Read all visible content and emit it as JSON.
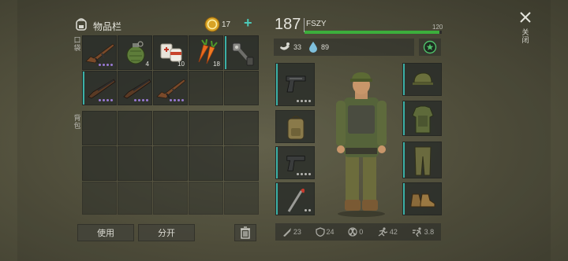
{
  "header": {
    "inventory_title": "物品栏",
    "coins_value": "17",
    "add_label": "+",
    "close_label": "关闭"
  },
  "side_labels": {
    "pockets": "口袋",
    "backpack": "背包"
  },
  "pocket_items": [
    {
      "name": "ak-rifle",
      "count": "",
      "dots": 4
    },
    {
      "name": "grenade",
      "count": "4",
      "dots": 0
    },
    {
      "name": "bandage-pills",
      "count": "10",
      "dots": 0
    },
    {
      "name": "carrots",
      "count": "18",
      "dots": 0
    },
    {
      "name": "mechanism",
      "count": "",
      "dots": 0
    },
    {
      "name": "shotgun",
      "count": "",
      "dots": 4
    },
    {
      "name": "shotgun",
      "count": "",
      "dots": 4
    },
    {
      "name": "ak-rifle",
      "count": "",
      "dots": 4
    }
  ],
  "player": {
    "level": "187",
    "name": "FSZY",
    "xp_text": "120",
    "xp_fraction": 0.98,
    "food": "33",
    "water": "89"
  },
  "buttons": {
    "use": "使用",
    "split": "分开"
  },
  "stats": {
    "attack": "23",
    "defense": "24",
    "radiation": "0",
    "speed": "42",
    "run": "3.8"
  },
  "colors": {
    "xp_bar": "#3cae3c",
    "accent": "#3bb0a6",
    "quality_dot": "#9a7ad6"
  }
}
